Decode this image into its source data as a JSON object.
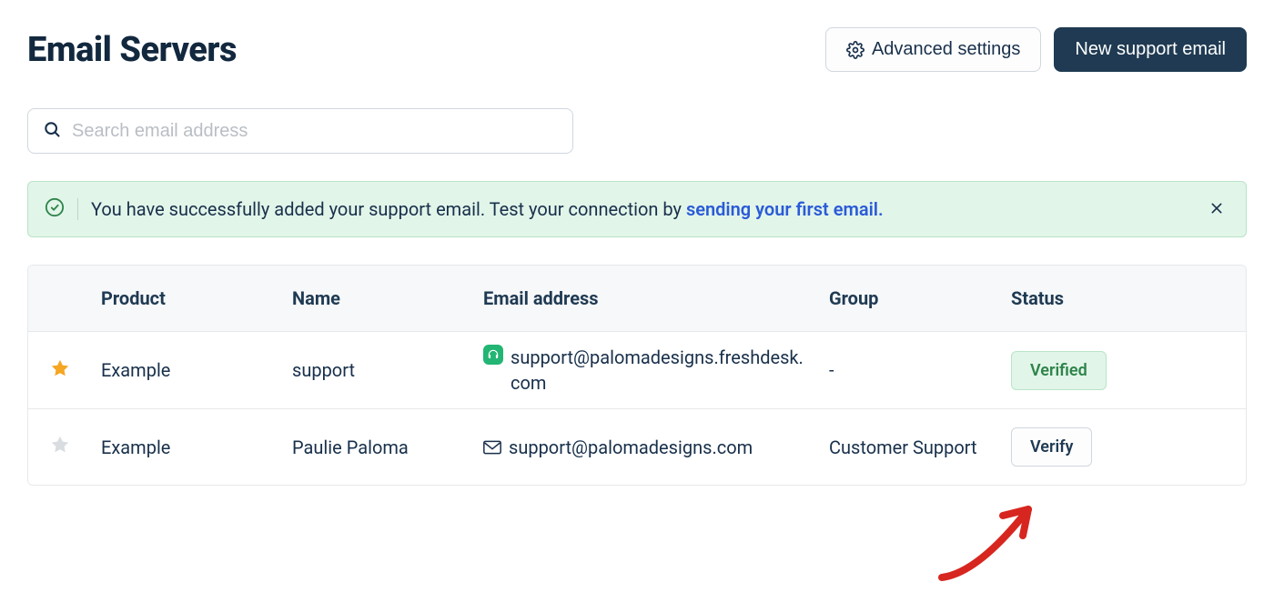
{
  "header": {
    "title": "Email Servers",
    "advanced_settings_label": "Advanced settings",
    "new_support_email_label": "New support email"
  },
  "search": {
    "placeholder": "Search email address"
  },
  "banner": {
    "text_prefix": "You have successfully added your support email. Test your connection by ",
    "link_text": "sending your first email."
  },
  "table": {
    "columns": {
      "product": "Product",
      "name": "Name",
      "email": "Email address",
      "group": "Group",
      "status": "Status"
    },
    "rows": [
      {
        "starred": true,
        "product": "Example",
        "name": "support",
        "email": "support@palomadesigns.freshdesk.com",
        "email_icon": "freshdesk",
        "group": "-",
        "status_label": "Verified",
        "status_kind": "verified"
      },
      {
        "starred": false,
        "product": "Example",
        "name": "Paulie Paloma",
        "email": "support@palomadesigns.com",
        "email_icon": "envelope",
        "group": "Customer Support",
        "status_label": "Verify",
        "status_kind": "verify"
      }
    ]
  }
}
